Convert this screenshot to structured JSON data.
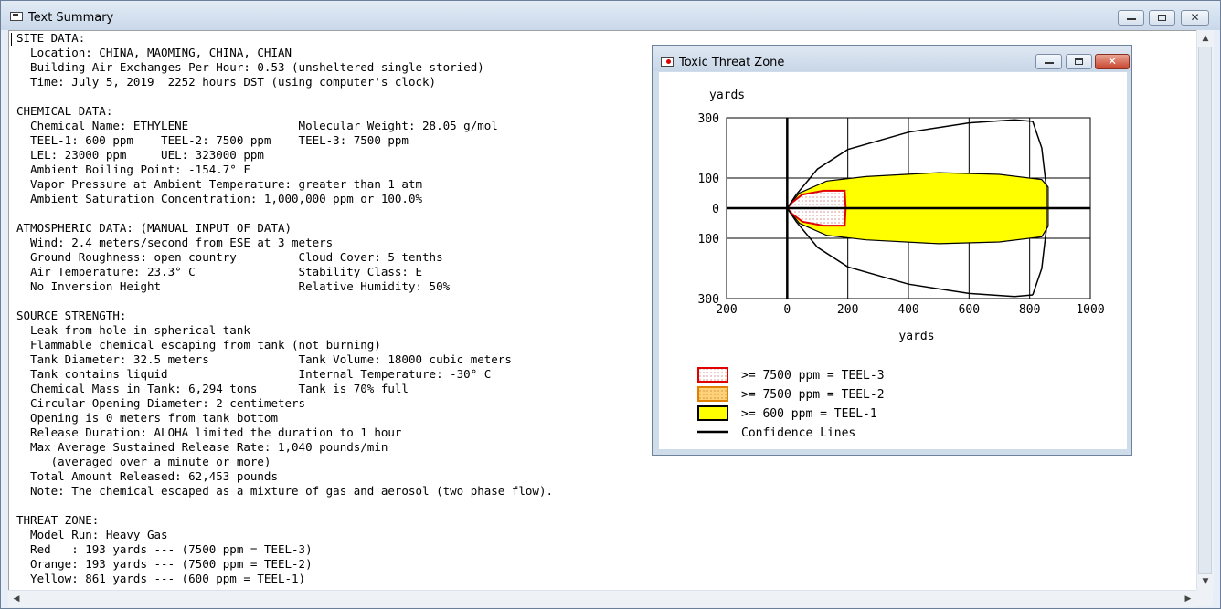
{
  "window": {
    "title": "Text Summary",
    "icon": "text-window-icon",
    "buttons": {
      "minimize": "minimize-icon",
      "maximize": "maximize-icon",
      "close": "close-icon"
    }
  },
  "report_lines": [
    "SITE DATA:",
    "  Location: CHINA, MAOMING, CHINA, CHIAN",
    "  Building Air Exchanges Per Hour: 0.53 (unsheltered single storied)",
    "  Time: July 5, 2019  2252 hours DST (using computer's clock)",
    "",
    "CHEMICAL DATA:",
    "  Chemical Name: ETHYLENE                Molecular Weight: 28.05 g/mol",
    "  TEEL-1: 600 ppm    TEEL-2: 7500 ppm    TEEL-3: 7500 ppm",
    "  LEL: 23000 ppm     UEL: 323000 ppm",
    "  Ambient Boiling Point: -154.7° F",
    "  Vapor Pressure at Ambient Temperature: greater than 1 atm",
    "  Ambient Saturation Concentration: 1,000,000 ppm or 100.0%",
    "",
    "ATMOSPHERIC DATA: (MANUAL INPUT OF DATA)",
    "  Wind: 2.4 meters/second from ESE at 3 meters",
    "  Ground Roughness: open country         Cloud Cover: 5 tenths",
    "  Air Temperature: 23.3° C               Stability Class: E",
    "  No Inversion Height                    Relative Humidity: 50%",
    "",
    "SOURCE STRENGTH:",
    "  Leak from hole in spherical tank",
    "  Flammable chemical escaping from tank (not burning)",
    "  Tank Diameter: 32.5 meters             Tank Volume: 18000 cubic meters",
    "  Tank contains liquid                   Internal Temperature: -30° C",
    "  Chemical Mass in Tank: 6,294 tons      Tank is 70% full",
    "  Circular Opening Diameter: 2 centimeters",
    "  Opening is 0 meters from tank bottom",
    "  Release Duration: ALOHA limited the duration to 1 hour",
    "  Max Average Sustained Release Rate: 1,040 pounds/min",
    "     (averaged over a minute or more)",
    "  Total Amount Released: 62,453 pounds",
    "  Note: The chemical escaped as a mixture of gas and aerosol (two phase flow).",
    "",
    "THREAT ZONE:",
    "  Model Run: Heavy Gas",
    "  Red   : 193 yards --- (7500 ppm = TEEL-3)",
    "  Orange: 193 yards --- (7500 ppm = TEEL-2)",
    "  Yellow: 861 yards --- (600 ppm = TEEL-1)"
  ],
  "threat_window": {
    "title": "Toxic Threat Zone",
    "icon": "threat-zone-icon"
  },
  "chart_data": {
    "type": "area",
    "ylabel": "yards",
    "xlabel": "yards",
    "xlim": [
      -200,
      1000
    ],
    "ylim": [
      -300,
      300
    ],
    "x_ticks": [
      -200,
      0,
      200,
      400,
      600,
      800,
      1000
    ],
    "x_tick_labels": [
      "200",
      "0",
      "200",
      "400",
      "600",
      "800",
      "1000"
    ],
    "y_ticks": [
      300,
      100,
      0,
      -100,
      -300
    ],
    "y_tick_labels": [
      "300",
      "100",
      "0",
      "100",
      "300"
    ],
    "grid": true,
    "zones": [
      {
        "name": "TEEL-3 (red)",
        "color": "#e00000",
        "fill": "dotted",
        "outline": [
          [
            0,
            0
          ],
          [
            15,
            18
          ],
          [
            50,
            45
          ],
          [
            120,
            58
          ],
          [
            190,
            58
          ],
          [
            193,
            0
          ],
          [
            190,
            -58
          ],
          [
            120,
            -58
          ],
          [
            50,
            -45
          ],
          [
            15,
            -18
          ],
          [
            0,
            0
          ]
        ]
      },
      {
        "name": "TEEL-1 (yellow)",
        "color": "#ffff00",
        "outline": [
          [
            0,
            0
          ],
          [
            40,
            50
          ],
          [
            130,
            90
          ],
          [
            260,
            105
          ],
          [
            500,
            118
          ],
          [
            700,
            112
          ],
          [
            840,
            95
          ],
          [
            861,
            70
          ],
          [
            861,
            -60
          ],
          [
            840,
            -95
          ],
          [
            700,
            -112
          ],
          [
            500,
            -118
          ],
          [
            260,
            -105
          ],
          [
            130,
            -90
          ],
          [
            40,
            -50
          ],
          [
            0,
            0
          ]
        ]
      }
    ],
    "confidence_lines": {
      "upper": [
        [
          0,
          0
        ],
        [
          30,
          45
        ],
        [
          100,
          130
        ],
        [
          200,
          195
        ],
        [
          400,
          252
        ],
        [
          600,
          283
        ],
        [
          750,
          293
        ],
        [
          810,
          288
        ]
      ],
      "lower": [
        [
          0,
          0
        ],
        [
          30,
          -45
        ],
        [
          100,
          -130
        ],
        [
          200,
          -195
        ],
        [
          400,
          -252
        ],
        [
          600,
          -283
        ],
        [
          750,
          -293
        ],
        [
          810,
          -288
        ]
      ],
      "arc": [
        [
          810,
          288
        ],
        [
          840,
          200
        ],
        [
          855,
          70
        ],
        [
          855,
          -70
        ],
        [
          840,
          -200
        ],
        [
          810,
          -288
        ]
      ]
    },
    "legend": [
      {
        "swatch": "red-dotted",
        "label": ">= 7500 ppm = TEEL-3"
      },
      {
        "swatch": "orange-dotted",
        "label": ">= 7500 ppm = TEEL-2"
      },
      {
        "swatch": "yellow",
        "label": ">= 600 ppm = TEEL-1"
      },
      {
        "swatch": "line",
        "label": "Confidence Lines"
      }
    ]
  }
}
